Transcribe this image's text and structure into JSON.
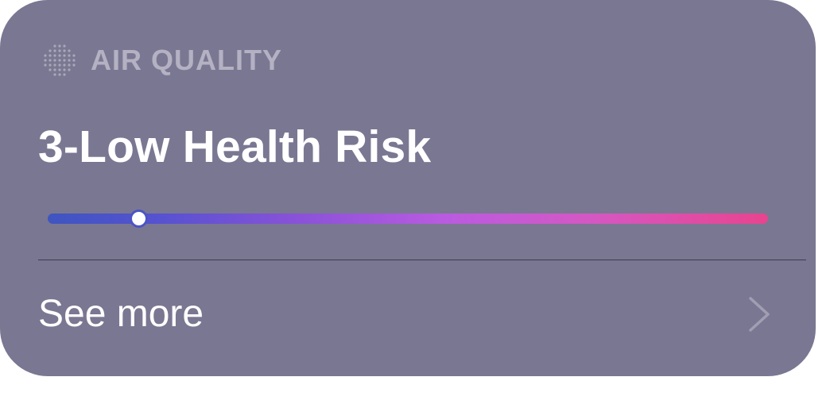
{
  "widget": {
    "header": {
      "icon": "air-quality-dots-icon",
      "title": "AIR QUALITY"
    },
    "headline": "3-Low Health Risk",
    "scale": {
      "level_fraction": 0.126,
      "gradient_colors": [
        "#3f55c0",
        "#5552d0",
        "#8a52d8",
        "#b95be0",
        "#d458c4",
        "#e8448f"
      ]
    },
    "footer": {
      "see_more_label": "See more",
      "chevron_icon": "chevron-right-icon"
    },
    "colors": {
      "card_background": "#7a7792",
      "header_text": "#b4b1c3",
      "primary_text": "#ffffff"
    }
  }
}
